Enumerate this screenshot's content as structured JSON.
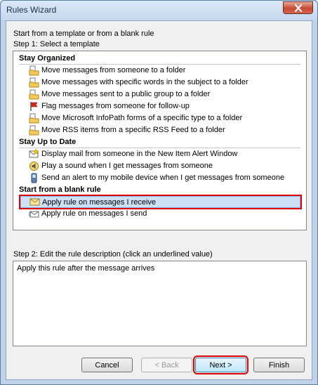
{
  "window": {
    "title": "Rules Wizard",
    "close_glyph": "✕"
  },
  "intro": {
    "line1": "Start from a template or from a blank rule",
    "line2": "Step 1: Select a template"
  },
  "groups": [
    {
      "header": "Stay Organized",
      "items": [
        {
          "label": "Move messages from someone to a folder",
          "icon": "folder-move-icon"
        },
        {
          "label": "Move messages with specific words in the subject to a folder",
          "icon": "folder-move-icon"
        },
        {
          "label": "Move messages sent to a public group to a folder",
          "icon": "folder-move-icon"
        },
        {
          "label": "Flag messages from someone for follow-up",
          "icon": "red-flag-icon"
        },
        {
          "label": "Move Microsoft InfoPath forms of a specific type to a folder",
          "icon": "folder-move-icon"
        },
        {
          "label": "Move RSS items from a specific RSS Feed to a folder",
          "icon": "folder-move-icon"
        }
      ]
    },
    {
      "header": "Stay Up to Date",
      "items": [
        {
          "label": "Display mail from someone in the New Item Alert Window",
          "icon": "alert-window-icon"
        },
        {
          "label": "Play a sound when I get messages from someone",
          "icon": "speaker-icon"
        },
        {
          "label": "Send an alert to my mobile device when I get messages from someone",
          "icon": "mobile-phone-icon"
        }
      ]
    },
    {
      "header": "Start from a blank rule",
      "items": [
        {
          "label": "Apply rule on messages I receive",
          "icon": "envelope-icon",
          "selected": true
        },
        {
          "label": "Apply rule on messages I send",
          "icon": "send-envelope-icon"
        }
      ]
    }
  ],
  "step2": {
    "label": "Step 2: Edit the rule description (click an underlined value)",
    "description": "Apply this rule after the message arrives"
  },
  "buttons": {
    "cancel": "Cancel",
    "back": "< Back",
    "next": "Next >",
    "finish": "Finish"
  }
}
